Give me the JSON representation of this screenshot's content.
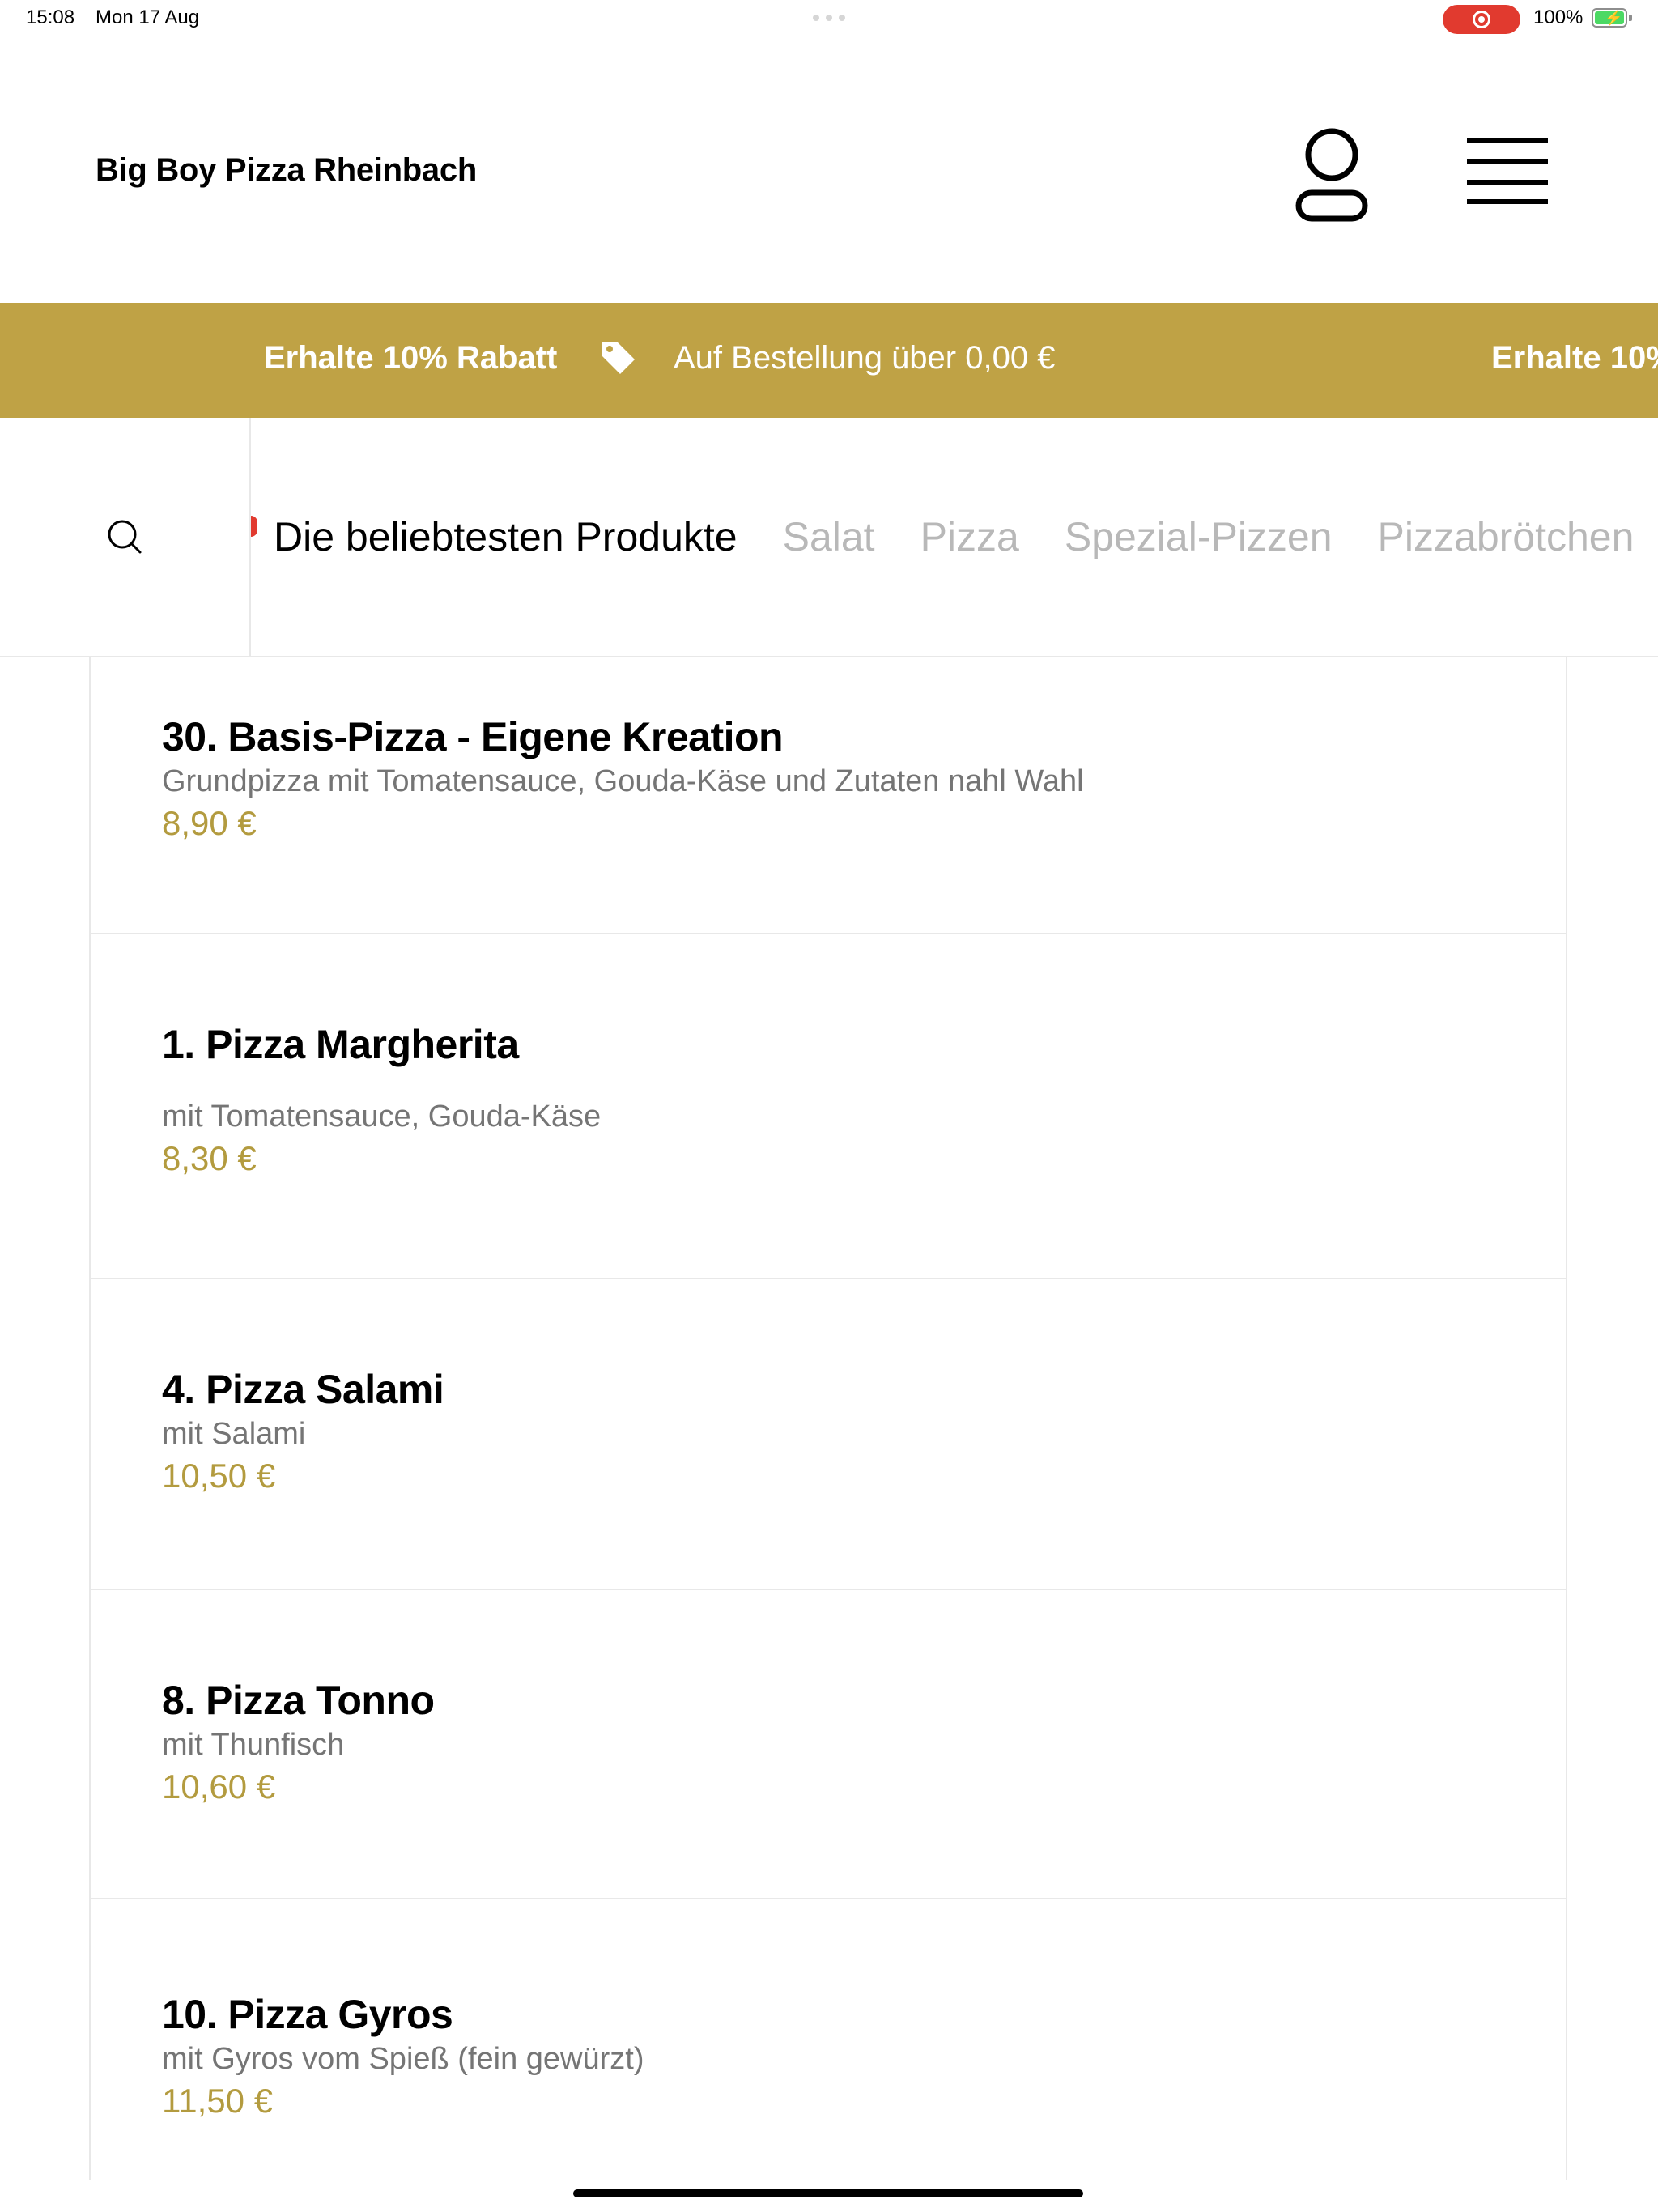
{
  "status_bar": {
    "time": "15:08",
    "date": "Mon 17 Aug",
    "battery_percent": "100%",
    "recording_color": "#e13a2f"
  },
  "header": {
    "title": "Big Boy Pizza Rheinbach",
    "account_icon": "person-icon",
    "menu_icon": "hamburger-icon"
  },
  "promo": {
    "background": "#bfa245",
    "headline": "Erhalte 10% Rabatt",
    "detail": "Auf Bestellung über 0,00 €",
    "headline_repeat": "Erhalte 10%",
    "icon": "tag-icon"
  },
  "categories": {
    "search_icon": "search-icon",
    "tabs": [
      {
        "label": "Die beliebtesten Produkte",
        "active": true
      },
      {
        "label": "Salat",
        "active": false
      },
      {
        "label": "Pizza",
        "active": false
      },
      {
        "label": "Spezial-Pizzen",
        "active": false
      },
      {
        "label": "Pizzabrötchen",
        "active": false
      }
    ]
  },
  "products": [
    {
      "name": "30. Basis-Pizza - Eigene Kreation",
      "description": "Grundpizza mit Tomatensauce, Gouda-Käse und Zutaten nahl Wahl",
      "price": "8,90 €"
    },
    {
      "name": "1. Pizza Margherita",
      "description": "mit Tomatensauce, Gouda-Käse",
      "price": "8,30 €"
    },
    {
      "name": "4. Pizza Salami",
      "description": "mit Salami",
      "price": "10,50 €"
    },
    {
      "name": "8. Pizza Tonno",
      "description": "mit Thunfisch",
      "price": "10,60 €"
    },
    {
      "name": "10. Pizza Gyros",
      "description": "mit Gyros vom Spieß (fein gewürzt)",
      "price": "11,50 €"
    }
  ],
  "colors": {
    "accent": "#bfa245",
    "price": "#b39b3f",
    "inactive_tab": "#b8b8b8"
  }
}
